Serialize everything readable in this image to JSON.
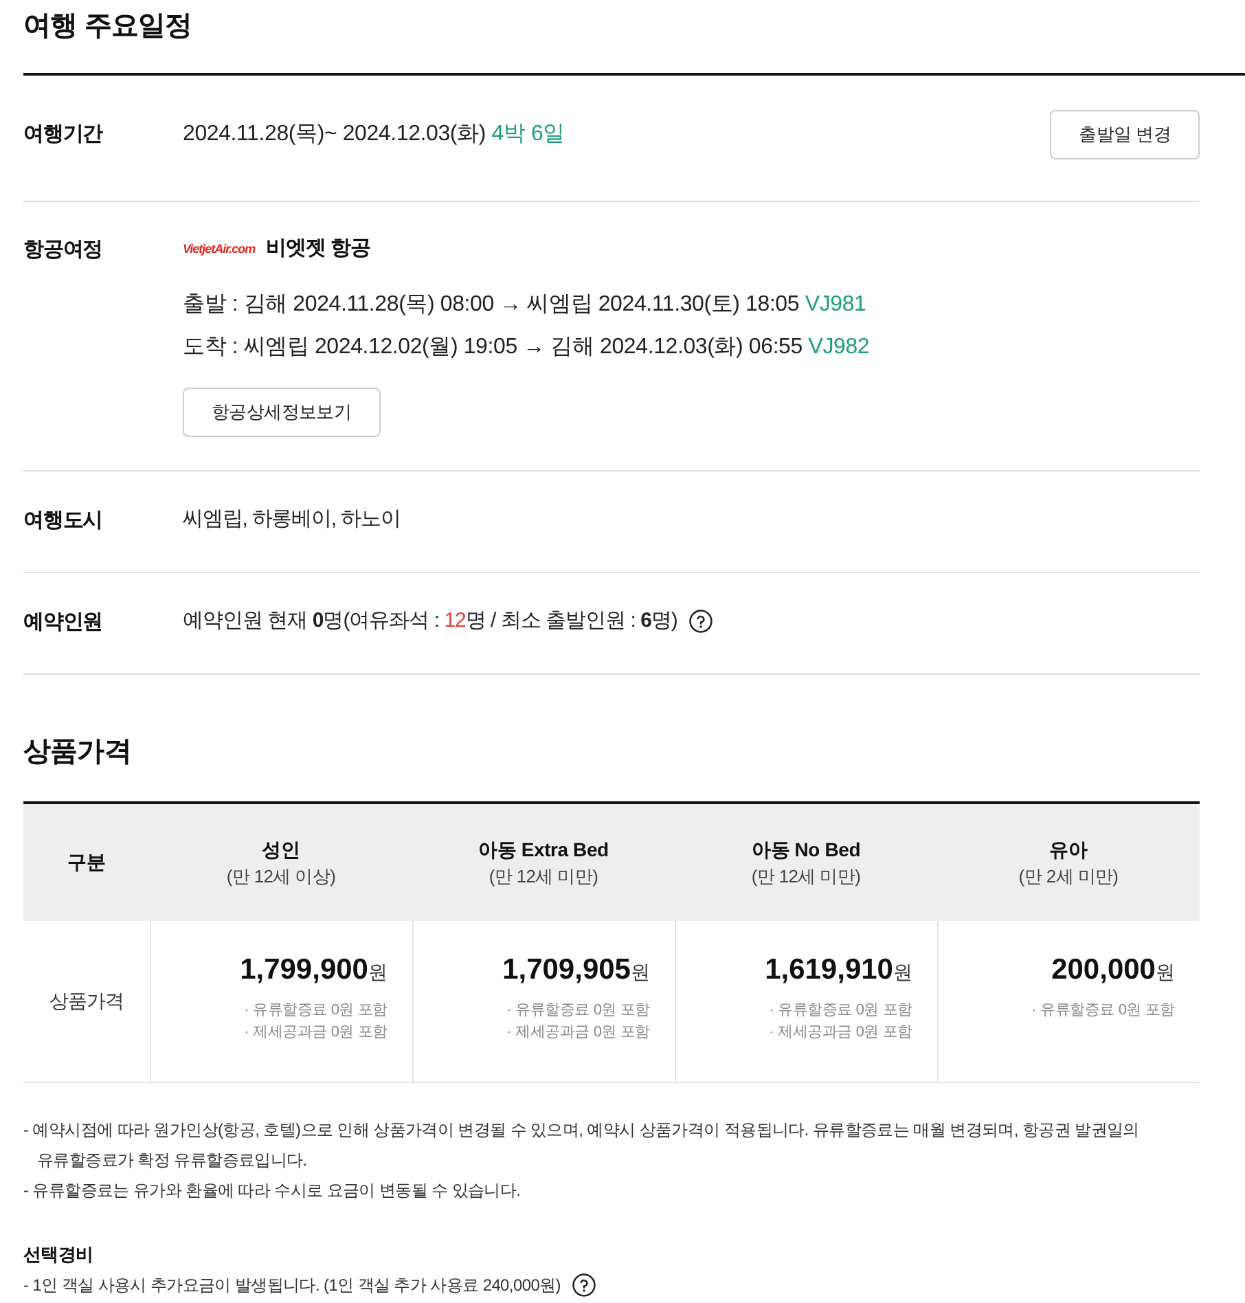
{
  "schedule": {
    "title": "여행 주요일정",
    "rows": [
      {
        "kind": "period",
        "label": "여행기간",
        "dates": "2024.11.28(목)~ 2024.12.03(화)",
        "duration": "4박 6일",
        "button": "출발일 변경"
      },
      {
        "kind": "flight",
        "label": "항공여정",
        "airline_logo": "VietjetAir.com",
        "airline": "비엣젯 항공",
        "legs": [
          {
            "text": "출발 : 김해 2024.11.28(목) 08:00 → 씨엠립 2024.11.30(토) 18:05",
            "flight_no": "VJ981"
          },
          {
            "text": "도착 : 씨엠립 2024.12.02(월) 19:05 → 김해 2024.12.03(화) 06:55",
            "flight_no": "VJ982"
          }
        ],
        "button": "항공상세정보보기"
      },
      {
        "kind": "text",
        "label": "여행도시",
        "value": "씨엠립, 하롱베이, 하노이"
      },
      {
        "kind": "booking",
        "label": "예약인원",
        "before": "예약인원 현재 **0**명(여유좌석 : ",
        "seats": "12",
        "after": "명 / 최소 출발인원 : **6**명)",
        "help_icon": true
      }
    ]
  },
  "pricing": {
    "title": "상품가격",
    "table": {
      "columns": [
        {
          "title": "구분"
        },
        {
          "title": "성인",
          "subtitle": "(만 12세 이상)"
        },
        {
          "title": "아동 Extra Bed",
          "subtitle": "(만 12세 미만)"
        },
        {
          "title": "아동 No Bed",
          "subtitle": "(만 12세 미만)"
        },
        {
          "title": "유아",
          "subtitle": "(만 2세 미만)"
        }
      ],
      "rows": [
        {
          "cells": [
            {
              "kind": "label",
              "text": "상품가격"
            },
            {
              "kind": "price",
              "amount": "1,799,900",
              "unit": "원",
              "notes": [
                "· 유류할증료 0원 포함",
                "· 제세공과금 0원 포함"
              ]
            },
            {
              "kind": "price",
              "amount": "1,709,905",
              "unit": "원",
              "notes": [
                "· 유류할증료 0원 포함",
                "· 제세공과금 0원 포함"
              ]
            },
            {
              "kind": "price",
              "amount": "1,619,910",
              "unit": "원",
              "notes": [
                "· 유류할증료 0원 포함",
                "· 제세공과금 0원 포함"
              ]
            },
            {
              "kind": "price",
              "amount": "200,000",
              "unit": "원",
              "notes": [
                "· 유류할증료 0원 포함"
              ]
            }
          ]
        }
      ]
    },
    "notes": [
      "- 예약시점에 따라 원가인상(항공, 호텔)으로 인해 상품가격이 변경될 수 있으며, 예약시 상품가격이 적용됩니다. 유류할증료는 매월 변경되며, 항공권 발권일의 유류할증료가 확정 유류할증료입니다.",
      "- 유류할증료는 유가와 환율에 따라 수시로 요금이 변동될 수 있습니다."
    ],
    "optional": {
      "title": "선택경비",
      "items": [
        {
          "text": "- 1인 객실 사용시 추가요금이 발생됩니다. (1인 객실 추가 사용료 240,000원)",
          "help_icon": true
        }
      ]
    }
  }
}
